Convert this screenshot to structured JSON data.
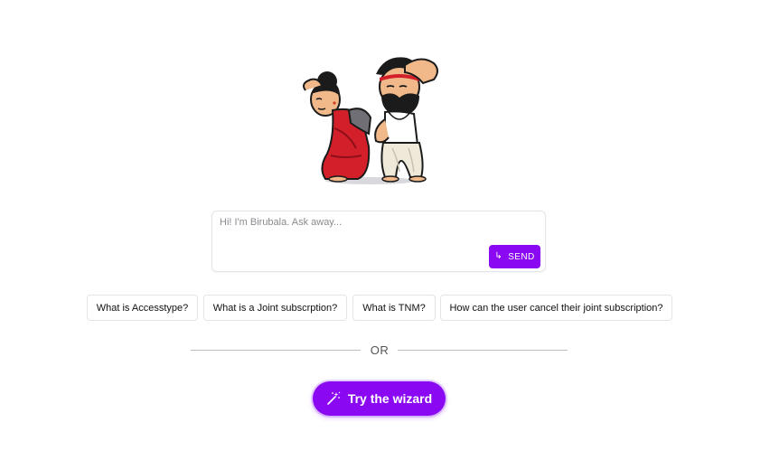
{
  "chat": {
    "placeholder": "Hi! I'm Birubala. Ask away...",
    "value": "",
    "send_label": "SEND",
    "send_icon": "return-arrow-icon"
  },
  "suggestions": [
    "What is Accesstype?",
    "What is a Joint subscrption?",
    "What is TNM?",
    "How can the user cancel their joint subscription?"
  ],
  "divider": {
    "label": "OR"
  },
  "wizard": {
    "label": "Try the wizard",
    "icon": "magic-wand-icon"
  },
  "colors": {
    "accent": "#8a09f2",
    "border": "#e3e3e8",
    "divider": "#bdbdc2"
  }
}
